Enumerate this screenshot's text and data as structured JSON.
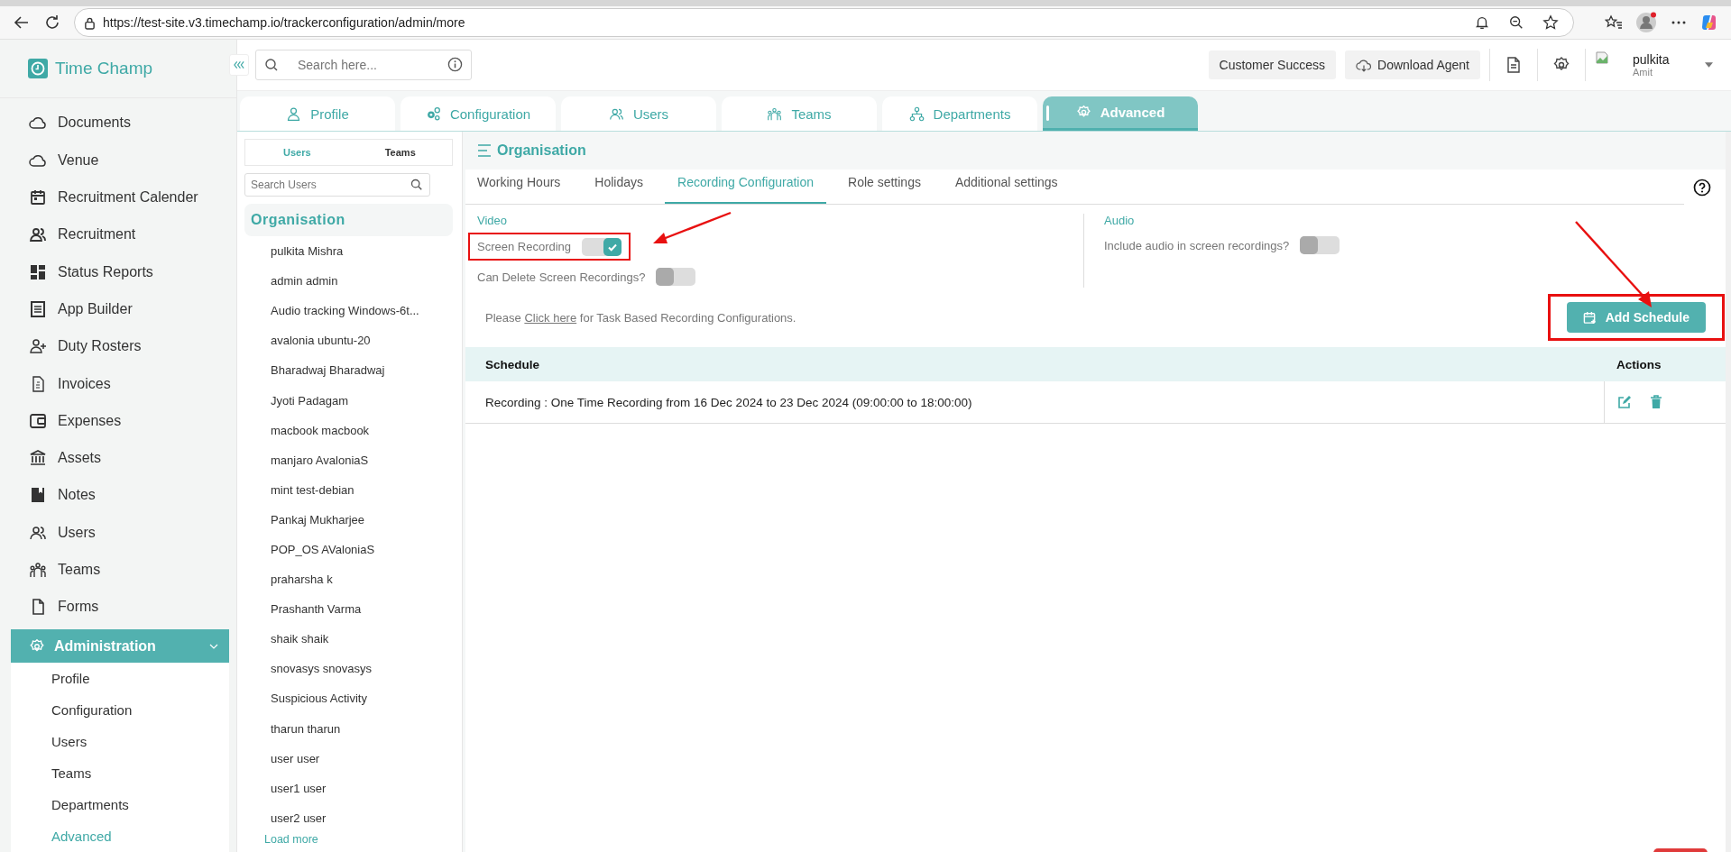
{
  "browser": {
    "url": "https://test-site.v3.timechamp.io/trackerconfiguration/admin/more"
  },
  "sidebar": {
    "logo": "Time Champ",
    "items": [
      {
        "label": "Documents"
      },
      {
        "label": "Venue"
      },
      {
        "label": "Recruitment Calender"
      },
      {
        "label": "Recruitment"
      },
      {
        "label": "Status Reports"
      },
      {
        "label": "App Builder"
      },
      {
        "label": "Duty Rosters"
      },
      {
        "label": "Invoices"
      },
      {
        "label": "Expenses"
      },
      {
        "label": "Assets"
      },
      {
        "label": "Notes"
      },
      {
        "label": "Users"
      },
      {
        "label": "Teams"
      },
      {
        "label": "Forms"
      }
    ],
    "section": {
      "label": "Administration",
      "expanded": true,
      "children": [
        {
          "label": "Profile",
          "selected": false
        },
        {
          "label": "Configuration",
          "selected": false
        },
        {
          "label": "Users",
          "selected": false
        },
        {
          "label": "Teams",
          "selected": false
        },
        {
          "label": "Departments",
          "selected": false
        },
        {
          "label": "Advanced",
          "selected": true
        }
      ]
    }
  },
  "header": {
    "search": {
      "placeholder": "Search here..."
    },
    "buttons": [
      "Customer Success",
      "Download Agent"
    ],
    "user": {
      "name": "pulkita",
      "role": "Amit"
    }
  },
  "tabs": [
    {
      "label": "Profile",
      "selected": false
    },
    {
      "label": "Configuration",
      "selected": false
    },
    {
      "label": "Users",
      "selected": false
    },
    {
      "label": "Teams",
      "selected": false
    },
    {
      "label": "Departments",
      "selected": false
    },
    {
      "label": "Advanced",
      "selected": true
    }
  ],
  "user_panel": {
    "tabs": [
      {
        "label": "Users",
        "selected": true
      },
      {
        "label": "Teams",
        "selected": false
      }
    ],
    "search": {
      "placeholder": "Search Users"
    },
    "group": "Organisation",
    "users": [
      "pulkita Mishra",
      "admin admin",
      "Audio tracking Windows-6t...",
      "avalonia ubuntu-20",
      "Bharadwaj Bharadwaj",
      "Jyoti Padagam",
      "macbook macbook",
      "manjaro AvaloniaS",
      "mint test-debian",
      "Pankaj Mukharjee",
      "POP_OS AValoniaS",
      "praharsha k",
      "Prashanth Varma",
      "shaik shaik",
      "snovasys snovasys",
      "Suspicious Activity",
      "tharun tharun",
      "user user",
      "user1 user",
      "user2 user"
    ],
    "load_more": "Load more"
  },
  "content": {
    "title": "Organisation",
    "subtabs": [
      {
        "label": "Working Hours",
        "selected": false
      },
      {
        "label": "Holidays",
        "selected": false
      },
      {
        "label": "Recording Configuration",
        "selected": true
      },
      {
        "label": "Role settings",
        "selected": false
      },
      {
        "label": "Additional settings",
        "selected": false
      }
    ],
    "video": {
      "heading": "Video",
      "toggles": [
        {
          "label": "Screen Recording",
          "on": true,
          "highlighted": true
        },
        {
          "label": "Can Delete Screen Recordings?",
          "on": false,
          "highlighted": false
        }
      ]
    },
    "audio": {
      "heading": "Audio",
      "toggles": [
        {
          "label": "Include audio in screen recordings?",
          "on": false,
          "highlighted": false
        }
      ]
    },
    "note": {
      "before": "Please ",
      "link": "Click here",
      "after": " for Task Based Recording Configurations."
    },
    "add_button": {
      "label": "Add Schedule",
      "highlighted": true
    },
    "table": {
      "columns": [
        "Schedule",
        "Actions"
      ],
      "rows": [
        {
          "schedule": "Recording : One Time Recording from 16 Dec 2024 to 23 Dec 2024 (09:00:00 to 18:00:00)"
        }
      ]
    }
  }
}
